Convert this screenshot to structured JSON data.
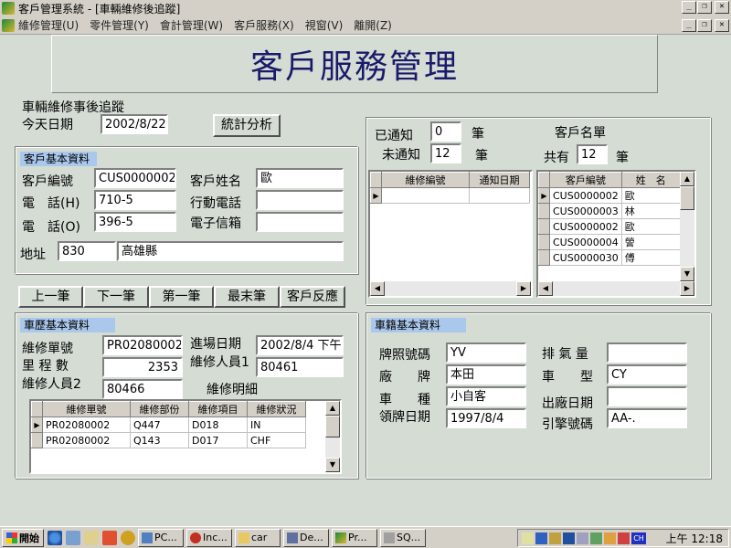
{
  "window": {
    "title": "客戶管理系統 - [車輛維修後追蹤]"
  },
  "menu": [
    "維修管理(U)",
    "零件管理(Y)",
    "會計管理(W)",
    "客戶服務(X)",
    "視窗(V)",
    "離開(Z)"
  ],
  "header": {
    "title": "客戶服務管理"
  },
  "top": {
    "section_label": "車輛維修事後追蹤",
    "date_label": "今天日期",
    "date_value": "2002/8/22",
    "stats_button": "統計分析"
  },
  "customer": {
    "title": "客戶基本資料",
    "id_label": "客戶編號",
    "id_value": "CUS0000002",
    "name_label": "客戶姓名",
    "name_value": "歐",
    "phone_h_label": "電　話(H)",
    "phone_h_value": "710-5",
    "mobile_label": "行動電話",
    "mobile_value": "",
    "phone_o_label": "電　話(O)",
    "phone_o_value": "396-5",
    "email_label": "電子信箱",
    "email_value": "",
    "addr_label": "地址",
    "zip_value": "830",
    "addr_value": "高雄縣"
  },
  "nav": {
    "first": "上一筆",
    "prev": "下一筆",
    "next": "第一筆",
    "last": "最末筆",
    "feedback": "客戶反應"
  },
  "notify": {
    "notified_label": "已通知",
    "notified_value": "0",
    "unit1": "筆",
    "unnotified_label": "未通知",
    "unnotified_value": "12",
    "unit2": "筆",
    "list_title": "客戶名單",
    "total_label": "共有",
    "total_value": "12",
    "unit3": "筆",
    "left_grid": {
      "headers": [
        "維修編號",
        "通知日期"
      ],
      "rows": [
        [
          "",
          ""
        ]
      ]
    },
    "right_grid": {
      "headers": [
        "客戶編號",
        "姓　名"
      ],
      "rows": [
        [
          "CUS0000002",
          "歐"
        ],
        [
          "CUS0000003",
          "林"
        ],
        [
          "CUS0000002",
          "歐"
        ],
        [
          "CUS0000004",
          "謍"
        ],
        [
          "CUS0000030",
          "傅"
        ]
      ]
    }
  },
  "history": {
    "title": "車歷基本資料",
    "order_label": "維修單號",
    "order_value": "PR02080002",
    "date_label": "進場日期",
    "date_value": "2002/8/4 下午",
    "mileage_label": "里 程 數",
    "mileage_value": "2353",
    "staff1_label": "維修人員1",
    "staff1_value": "80461",
    "staff2_label": "維修人員2",
    "staff2_value": "80466",
    "detail_label": "維修明細",
    "grid": {
      "headers": [
        "維修單號",
        "維修部份",
        "維修項目",
        "維修狀況"
      ],
      "rows": [
        [
          "PR02080002",
          "Q447",
          "D018",
          "IN"
        ],
        [
          "PR02080002",
          "Q143",
          "D017",
          "CHF"
        ]
      ]
    }
  },
  "vehicle": {
    "title": "車籍基本資料",
    "plate_label": "牌照號碼",
    "plate_value": "YV",
    "cc_label": "排 氣 量",
    "cc_value": "",
    "brand_label": "廠　　牌",
    "brand_value": "本田",
    "model_label": "車　　型",
    "model_value": "CY",
    "type_label": "車　　種",
    "type_value": "小自客",
    "mfg_label": "出廠日期",
    "mfg_value": "",
    "reg_label": "領牌日期",
    "reg_value": "1997/8/4",
    "engine_label": "引擎號碼",
    "engine_value": "AA-."
  },
  "taskbar": {
    "start": "開始",
    "tasks": [
      "PC...",
      "Inc...",
      "car",
      "De...",
      "Pr...",
      "SQ..."
    ],
    "clock": "上午 12:18",
    "ime": "CH"
  }
}
